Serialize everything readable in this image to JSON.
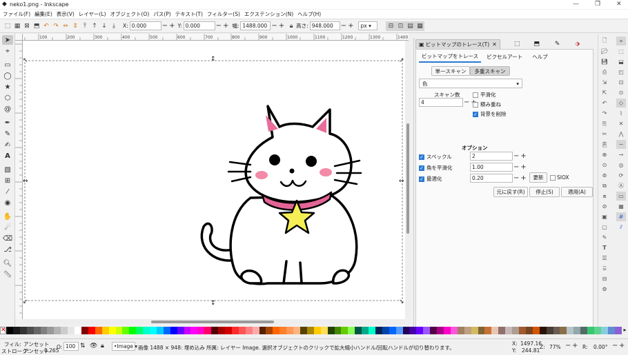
{
  "window": {
    "title": "neko1.png - Inkscape"
  },
  "menu": [
    "ファイル(F)",
    "編集(E)",
    "表示(V)",
    "レイヤー(L)",
    "オブジェクト(O)",
    "パス(P)",
    "テキスト(T)",
    "フィルター(S)",
    "エクステンション(N)",
    "ヘルプ(H)"
  ],
  "toolbar": {
    "x_label": "X:",
    "x_value": "0.000",
    "y_label": "Y:",
    "y_value": "0.000",
    "w_label": "幅:",
    "w_value": "1488.000",
    "h_label": "高さ:",
    "h_value": "948.000",
    "unit": "px"
  },
  "ruler_ticks": [
    "",
    "100",
    "",
    "200",
    "",
    "300",
    "",
    "400",
    "",
    "500",
    "",
    "600",
    "",
    "700",
    "",
    "800",
    "",
    "900",
    "",
    "1000",
    "",
    "1100",
    "",
    "1200",
    "",
    "1300",
    "",
    "1400"
  ],
  "dock": {
    "tab_title": "ビットマップのトレース(T)",
    "subtabs": [
      "ビットマップをトレース",
      "ピクセルアート",
      "ヘルプ"
    ],
    "scan_single": "単一スキャン",
    "scan_multi": "多重スキャン",
    "mode": "色",
    "scans_label": "スキャン数",
    "scans_value": "4",
    "smooth": "平滑化",
    "stack": "積み重ね",
    "remove_bg": "背景を削除",
    "options_title": "オプション",
    "speckles": "スペックル",
    "speckles_value": "2",
    "smooth_corners": "角を平滑化",
    "smooth_corners_value": "1.00",
    "optimize": "最適化",
    "optimize_value": "0.20",
    "update": "更新",
    "siox": "SIOX",
    "undo": "元に戻す(R)",
    "stop": "停止(S)",
    "apply": "適用(A)"
  },
  "status": {
    "fill_label": "フィル:",
    "fill_value": "アンセット",
    "stroke_label": "ストローク:",
    "stroke_value": "アンセット",
    "stroke_width": "0.265",
    "opacity_label": "O:",
    "opacity_value": "100",
    "layer": "•Image",
    "message": "画像 1488 × 948: 埋め込み 所属: レイヤー Image. 選択オブジェクトのクリックで拡大縮小ハンドル/回転ハンドルが切り替わります。",
    "x_label": "X:",
    "x_value": "1497.16",
    "y_label": "Y:",
    "y_value": "244.81",
    "zoom_label": "Z:",
    "zoom_value": "77%",
    "rot_label": "R:",
    "rot_value": "0.00°"
  },
  "palette_colors": [
    "#000000",
    "#1a1a1a",
    "#333333",
    "#4d4d4d",
    "#666666",
    "#808080",
    "#999999",
    "#b3b3b3",
    "#cccccc",
    "#e6e6e6",
    "#ffffff",
    "#800000",
    "#ff0000",
    "#ff6600",
    "#ffcc00",
    "#ffff00",
    "#ccff00",
    "#66ff00",
    "#00ff00",
    "#00ff66",
    "#00ffcc",
    "#00ffff",
    "#00ccff",
    "#0066ff",
    "#0000ff",
    "#6600ff",
    "#cc00ff",
    "#ff00ff",
    "#ff00cc",
    "#ff0066",
    "#550000",
    "#aa0000",
    "#d40000",
    "#ff2a2a",
    "#ff5555",
    "#ff8080",
    "#ffaaaa",
    "#552200",
    "#aa4400",
    "#ff6600",
    "#ff7f2a",
    "#ff9955",
    "#ffb380",
    "#554400",
    "#aa8800",
    "#ffcc00",
    "#ffdd55",
    "#224400",
    "#448800",
    "#66cc00",
    "#88ff55",
    "#005544",
    "#00aa88",
    "#00ffcc",
    "#002255",
    "#0044aa",
    "#0066ff",
    "#5599ff",
    "#220055",
    "#4400aa",
    "#6600ff",
    "#9955ff",
    "#550044",
    "#aa0088",
    "#ff00cc",
    "#ff55dd",
    "#a08060",
    "#c0a080",
    "#d3bc5f",
    "#806633",
    "#c87137",
    "#e9c6af",
    "#916f6f",
    "#c8b7b7",
    "#ac9d93",
    "#a05a2c",
    "#784421",
    "#d45500",
    "#2b1100",
    "#483e37",
    "#6c5d53",
    "#8a6f48",
    "#b7c4c8",
    "#93a7ac",
    "#536c67",
    "#37c871",
    "#5fd38d",
    "#87cdde",
    "#5f8dd3",
    "#8d5fd3"
  ]
}
